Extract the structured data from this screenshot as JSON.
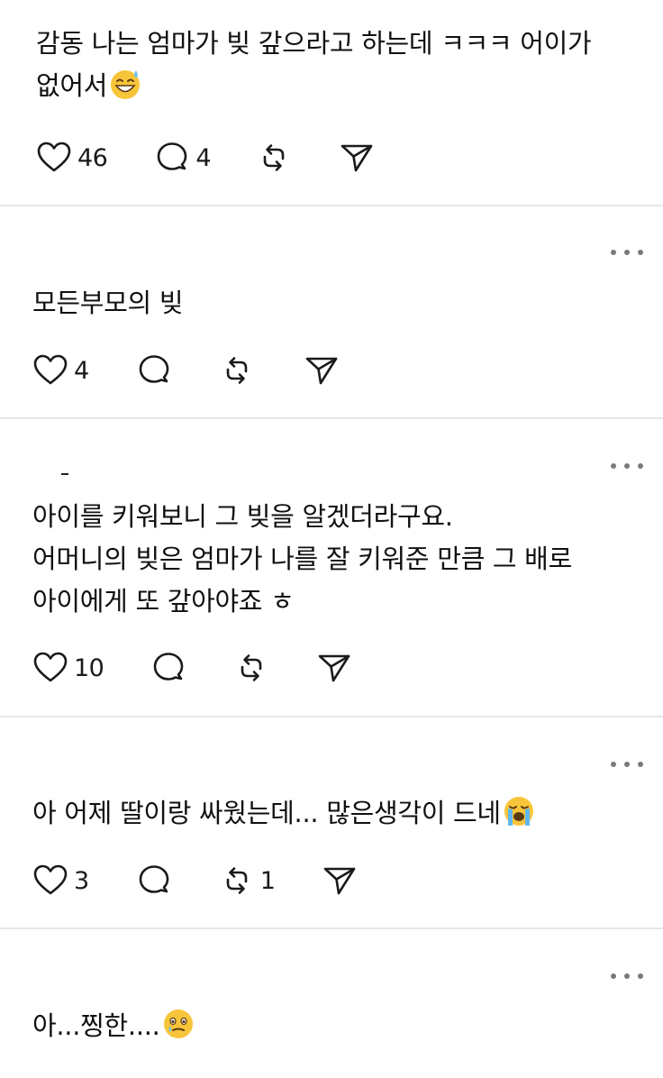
{
  "posts": [
    {
      "lines": [
        "감동 나는 엄마가 빚 갚으라고 하는데 ㅋㅋㅋ 어이가",
        "없어서"
      ],
      "emoji": "grinning-sweat-emoji",
      "likes": "46",
      "replies": "4",
      "reposts": ""
    },
    {
      "lines": [
        "모든부모의 빚"
      ],
      "likes": "4",
      "replies": "",
      "reposts": ""
    },
    {
      "lines": [
        "아이를 키워보니 그 빚을 알겠더라구요.",
        "어머니의 빚은 엄마가 나를 잘 키워준 만큼 그 배로",
        "아이에게 또 갚아야죠 ㅎ"
      ],
      "likes": "10",
      "replies": "",
      "reposts": ""
    },
    {
      "lines": [
        "아 어제 딸이랑 싸웠는데... 많은생각이 드네"
      ],
      "emoji": "loudly-crying-emoji",
      "likes": "3",
      "replies": "",
      "reposts": "1"
    },
    {
      "lines": [
        "아...찡한...."
      ],
      "emoji": "holding-back-tears-emoji"
    }
  ],
  "colors": {
    "icon": "#1a1a1a",
    "divider": "#e6e6e6",
    "more_dots": "#7a7a7a",
    "text": "#101010"
  },
  "icons": {
    "like": "heart-icon",
    "reply": "comment-bubble-icon",
    "repost": "repost-arrows-icon",
    "share": "send-paper-plane-icon",
    "more": "more-horizontal-icon"
  }
}
